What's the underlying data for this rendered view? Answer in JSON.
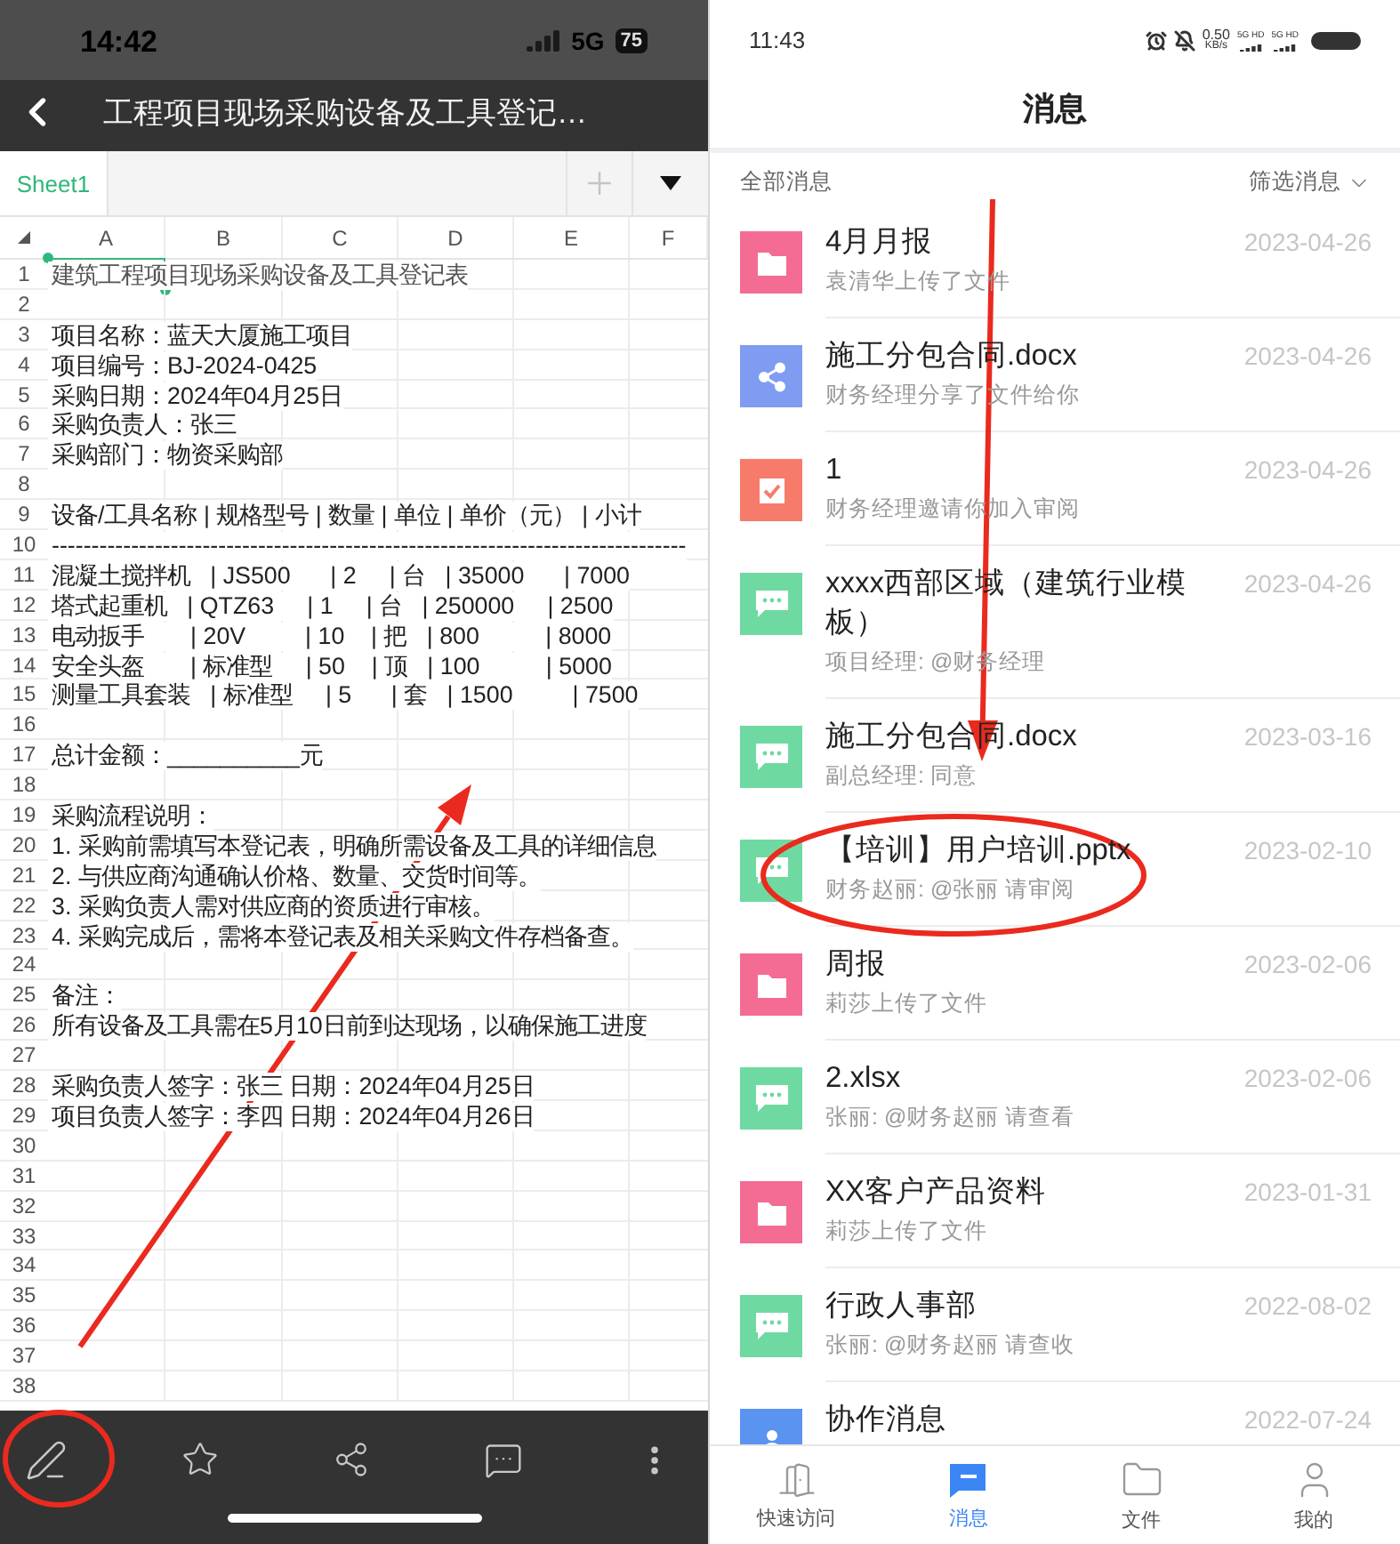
{
  "left_phone": {
    "status_bar": {
      "time": "14:42",
      "network": "5G",
      "battery": "75"
    },
    "title": "工程项目现场采购设备及工具登记…",
    "sheet_tabs": [
      {
        "label": "Sheet1",
        "selected": true
      }
    ],
    "columns": [
      "A",
      "B",
      "C",
      "D",
      "E",
      "F"
    ],
    "rows": [
      {
        "number": "1",
        "text": "建筑工程项目现场采购设备及工具登记表",
        "selected": true
      },
      {
        "number": "2",
        "selected": false
      },
      {
        "number": "3",
        "text": "项目名称：蓝天大厦施工项目",
        "selected": false
      },
      {
        "number": "4",
        "text": "项目编号：BJ-2024-0425",
        "selected": false
      },
      {
        "number": "5",
        "text": "采购日期：2024年04月25日",
        "selected": false
      },
      {
        "number": "6",
        "text": "采购负责人：张三",
        "selected": false
      },
      {
        "number": "7",
        "text": "采购部门：物资采购部",
        "selected": false
      },
      {
        "number": "8",
        "selected": false
      },
      {
        "number": "9",
        "text": "设备/工具名称 | 规格型号 | 数量 | 单位 | 单价（元） | 小计",
        "selected": false
      },
      {
        "number": "10",
        "text": "--------------------------------------------------------------------------------",
        "selected": false
      },
      {
        "number": "11",
        "text": "混凝土搅拌机   | JS500      | 2     | 台   | 35000      | 7000",
        "selected": false
      },
      {
        "number": "12",
        "text": "塔式起重机   | QTZ63     | 1     | 台   | 250000     | 2500",
        "selected": false
      },
      {
        "number": "13",
        "text": "电动扳手       | 20V         | 10    | 把   | 800          | 8000",
        "selected": false
      },
      {
        "number": "14",
        "text": "安全头盔       | 标准型     | 50    | 顶   | 100          | 5000",
        "selected": false
      },
      {
        "number": "15",
        "text": "测量工具套装   | 标准型     | 5      | 套   | 1500         | 7500",
        "selected": false
      },
      {
        "number": "16",
        "selected": false
      },
      {
        "number": "17",
        "text": "总计金额：__________元",
        "selected": false
      },
      {
        "number": "18",
        "selected": false
      },
      {
        "number": "19",
        "text": "采购流程说明：",
        "selected": false
      },
      {
        "number": "20",
        "text": "1. 采购前需填写本登记表，明确所需设备及工具的详细信息",
        "selected": false
      },
      {
        "number": "21",
        "text": "2. 与供应商沟通确认价格、数量、交货时间等。",
        "selected": false
      },
      {
        "number": "22",
        "text": "3. 采购负责人需对供应商的资质进行审核。",
        "selected": false
      },
      {
        "number": "23",
        "text": "4. 采购完成后，需将本登记表及相关采购文件存档备查。",
        "selected": false
      },
      {
        "number": "24",
        "selected": false
      },
      {
        "number": "25",
        "text": "备注：",
        "selected": false
      },
      {
        "number": "26",
        "text": "所有设备及工具需在5月10日前到达现场，以确保施工进度",
        "selected": false
      },
      {
        "number": "27",
        "selected": false
      },
      {
        "number": "28",
        "text": "采购负责人签字：张三 日期：2024年04月25日",
        "selected": false
      },
      {
        "number": "29",
        "text": "项目负责人签字：李四 日期：2024年04月26日",
        "selected": false
      },
      {
        "number": "30",
        "selected": false
      },
      {
        "number": "31",
        "selected": false
      },
      {
        "number": "32",
        "selected": false
      },
      {
        "number": "33",
        "selected": false
      },
      {
        "number": "34",
        "selected": false
      },
      {
        "number": "35",
        "selected": false
      },
      {
        "number": "36",
        "selected": false
      },
      {
        "number": "37",
        "selected": false
      },
      {
        "number": "38",
        "selected": false
      }
    ]
  },
  "right_phone": {
    "status_bar": {
      "time": "11:43",
      "speed": "0.50",
      "speed_unit": "KB/s",
      "signal_labels": [
        "5G HD",
        "5G HD"
      ]
    },
    "title": "消息",
    "filter": {
      "all_label": "全部消息",
      "filter_label": "筛选消息"
    },
    "messages": [
      {
        "kind": "folder",
        "title": "4月月报",
        "subtitle": "袁清华上传了文件",
        "date": "2023-04-26"
      },
      {
        "kind": "share",
        "title": "施工分包合同.docx",
        "subtitle": "财务经理分享了文件给你",
        "date": "2023-04-26"
      },
      {
        "kind": "review",
        "title": "1",
        "subtitle": "财务经理邀请你加入审阅",
        "date": "2023-04-26"
      },
      {
        "kind": "comment",
        "title": "xxxx西部区域（建筑行业模板）",
        "subtitle": "项目经理: @财务经理",
        "date": "2023-04-26"
      },
      {
        "kind": "comment",
        "title": "施工分包合同.docx",
        "subtitle": "副总经理: 同意",
        "date": "2023-03-16"
      },
      {
        "kind": "comment",
        "title": "【培训】用户培训.pptx",
        "subtitle": "财务赵丽: @张丽 请审阅",
        "date": "2023-02-10"
      },
      {
        "kind": "folder",
        "title": "周报",
        "subtitle": "莉莎上传了文件",
        "date": "2023-02-06"
      },
      {
        "kind": "comment",
        "title": "2.xlsx",
        "subtitle": "张丽: @财务赵丽 请查看",
        "date": "2023-02-06"
      },
      {
        "kind": "folder",
        "title": "XX客户产品资料",
        "subtitle": "莉莎上传了文件",
        "date": "2023-01-31"
      },
      {
        "kind": "comment",
        "title": "行政人事部",
        "subtitle": "张丽: @财务赵丽 请查收",
        "date": "2022-08-02"
      },
      {
        "kind": "collab",
        "title": "协作消息",
        "date": "2022-07-24"
      }
    ],
    "nav": [
      {
        "label": "快速访问",
        "selected": false
      },
      {
        "label": "消息",
        "selected": true
      },
      {
        "label": "文件",
        "selected": false
      },
      {
        "label": "我的",
        "selected": false
      }
    ]
  }
}
